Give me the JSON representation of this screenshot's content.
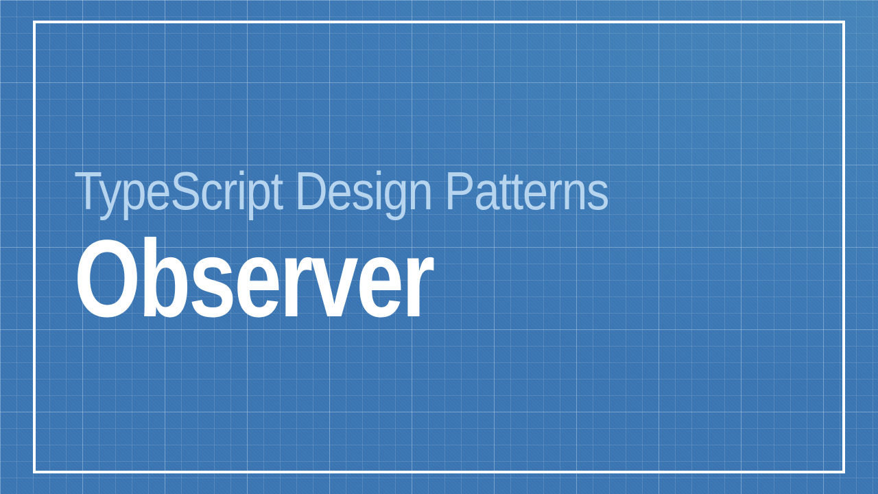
{
  "slide": {
    "subtitle": "TypeScript Design Patterns",
    "title": "Observer"
  },
  "colors": {
    "background": "#3b77b5",
    "frame": "#ffffff",
    "subtitle": "#b7d4ef",
    "title": "#ffffff"
  }
}
